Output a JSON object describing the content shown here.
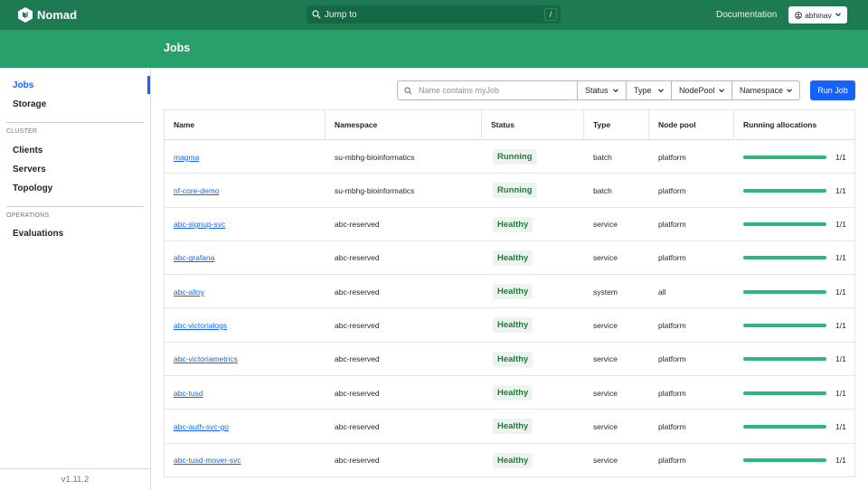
{
  "header": {
    "brand": "Nomad",
    "search_placeholder": "Jump to",
    "search_shortcut": "/",
    "documentation": "Documentation",
    "user": "abhinav"
  },
  "page": {
    "title": "Jobs"
  },
  "sidebar": {
    "items": [
      {
        "label": "Jobs",
        "active": true
      },
      {
        "label": "Storage"
      }
    ],
    "cluster_label": "CLUSTER",
    "cluster_items": [
      "Clients",
      "Servers",
      "Topology"
    ],
    "operations_label": "OPERATIONS",
    "operations_items": [
      "Evaluations"
    ],
    "version": "v1.11.2"
  },
  "toolbar": {
    "filter_placeholder": "Name contains myJob",
    "filters": [
      "Status",
      "Type",
      "NodePool",
      "Namespace"
    ],
    "run_job": "Run Job"
  },
  "table": {
    "columns": [
      "Name",
      "Namespace",
      "Status",
      "Type",
      "Node pool",
      "Running allocations"
    ],
    "rows": [
      {
        "name": "magma",
        "namespace": "su-mbhg-bioinformatics",
        "status": "Running",
        "type": "batch",
        "node_pool": "platform",
        "allocations": "1/1",
        "alloc_fraction": 1.0
      },
      {
        "name": "nf-core-demo",
        "namespace": "su-mbhg-bioinformatics",
        "status": "Running",
        "type": "batch",
        "node_pool": "platform",
        "allocations": "1/1",
        "alloc_fraction": 1.0
      },
      {
        "name": "abc-signup-svc",
        "namespace": "abc-reserved",
        "status": "Healthy",
        "type": "service",
        "node_pool": "platform",
        "allocations": "1/1",
        "alloc_fraction": 1.0
      },
      {
        "name": "abc-grafana",
        "namespace": "abc-reserved",
        "status": "Healthy",
        "type": "service",
        "node_pool": "platform",
        "allocations": "1/1",
        "alloc_fraction": 1.0
      },
      {
        "name": "abc-alloy",
        "namespace": "abc-reserved",
        "status": "Healthy",
        "type": "system",
        "node_pool": "all",
        "allocations": "1/1",
        "alloc_fraction": 1.0
      },
      {
        "name": "abc-victorialogs",
        "namespace": "abc-reserved",
        "status": "Healthy",
        "type": "service",
        "node_pool": "platform",
        "allocations": "1/1",
        "alloc_fraction": 1.0
      },
      {
        "name": "abc-victoriametrics",
        "namespace": "abc-reserved",
        "status": "Healthy",
        "type": "service",
        "node_pool": "platform",
        "allocations": "1/1",
        "alloc_fraction": 1.0
      },
      {
        "name": "abc-tusd",
        "namespace": "abc-reserved",
        "status": "Healthy",
        "type": "service",
        "node_pool": "platform",
        "allocations": "1/1",
        "alloc_fraction": 1.0
      },
      {
        "name": "abc-auth-svc-go",
        "namespace": "abc-reserved",
        "status": "Healthy",
        "type": "service",
        "node_pool": "platform",
        "allocations": "1/1",
        "alloc_fraction": 1.0
      },
      {
        "name": "abc-tusd-mover-svc",
        "namespace": "abc-reserved",
        "status": "Healthy",
        "type": "service",
        "node_pool": "platform",
        "allocations": "1/1",
        "alloc_fraction": 1.0
      }
    ]
  },
  "colors": {
    "topbar": "#1d7a53",
    "pagehead": "#27a06a",
    "accent": "#1563ff",
    "healthy_bg": "#ebf5ee",
    "healthy_text": "#1e7a3d",
    "alloc_bar": "#2eb67d"
  }
}
